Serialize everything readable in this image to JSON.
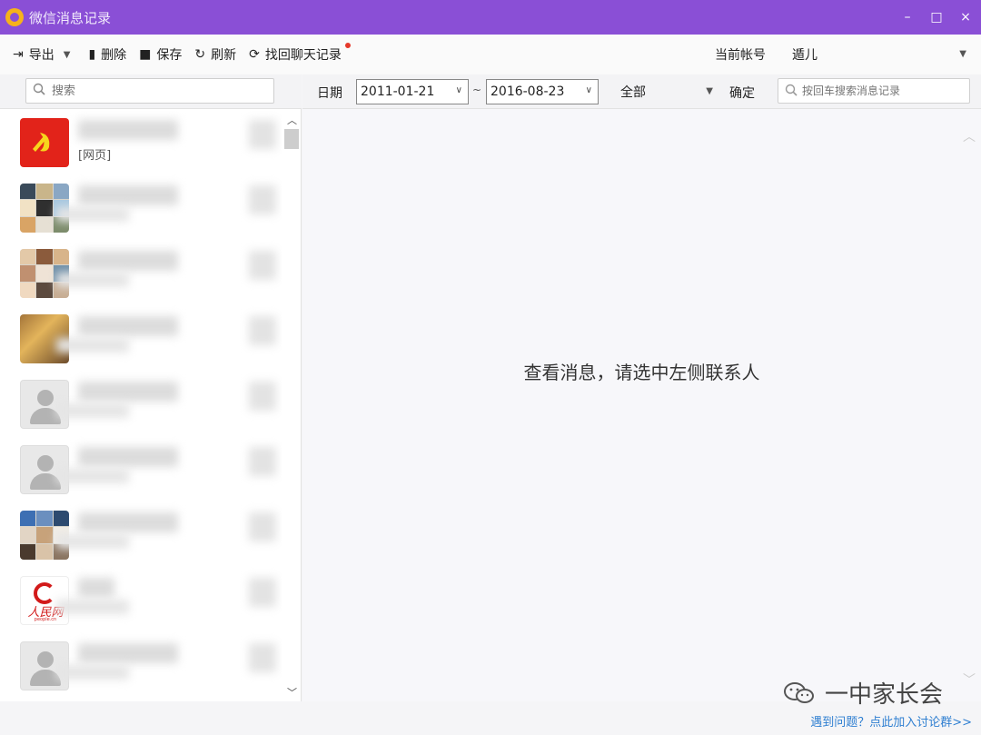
{
  "window": {
    "title": "微信消息记录",
    "controls": {
      "minimize": "–",
      "maximize": "□",
      "close": "×"
    }
  },
  "toolbar": {
    "export_label": "导出",
    "delete_label": "删除",
    "save_label": "保存",
    "refresh_label": "刷新",
    "recover_label": "找回聊天记录",
    "account_label": "当前帐号",
    "account_value": "遁儿"
  },
  "left": {
    "search_placeholder": "搜索",
    "contacts": [
      {
        "preview": "[网页]",
        "avatar": "party-emblem"
      },
      {
        "preview": "",
        "avatar": "group-grid"
      },
      {
        "preview": "",
        "avatar": "group-grid"
      },
      {
        "preview": "",
        "avatar": "photo"
      },
      {
        "preview": "",
        "avatar": "default"
      },
      {
        "preview": "",
        "avatar": "default"
      },
      {
        "preview": "",
        "avatar": "group-grid"
      },
      {
        "preview": "",
        "avatar": "people-daily"
      },
      {
        "preview": "",
        "avatar": "default"
      }
    ],
    "people_daily_text": "人民网",
    "people_daily_sub": "people.cn"
  },
  "filter": {
    "date_label": "日期",
    "start_date": "2011-01-21",
    "tilde": "~",
    "end_date": "2016-08-23",
    "type_value": "全部",
    "confirm_label": "确定",
    "msg_search_placeholder": "按回车搜索消息记录"
  },
  "main": {
    "empty_hint": "查看消息，请选中左侧联系人"
  },
  "footer": {
    "watermark": "一中家长会",
    "help_link": "遇到问题？点此加入讨论群>>"
  },
  "colors": {
    "titlebar": "#8a4fd6",
    "logo": "#f6b21b",
    "dot": "#e5392b",
    "link": "#2f7fd1"
  }
}
